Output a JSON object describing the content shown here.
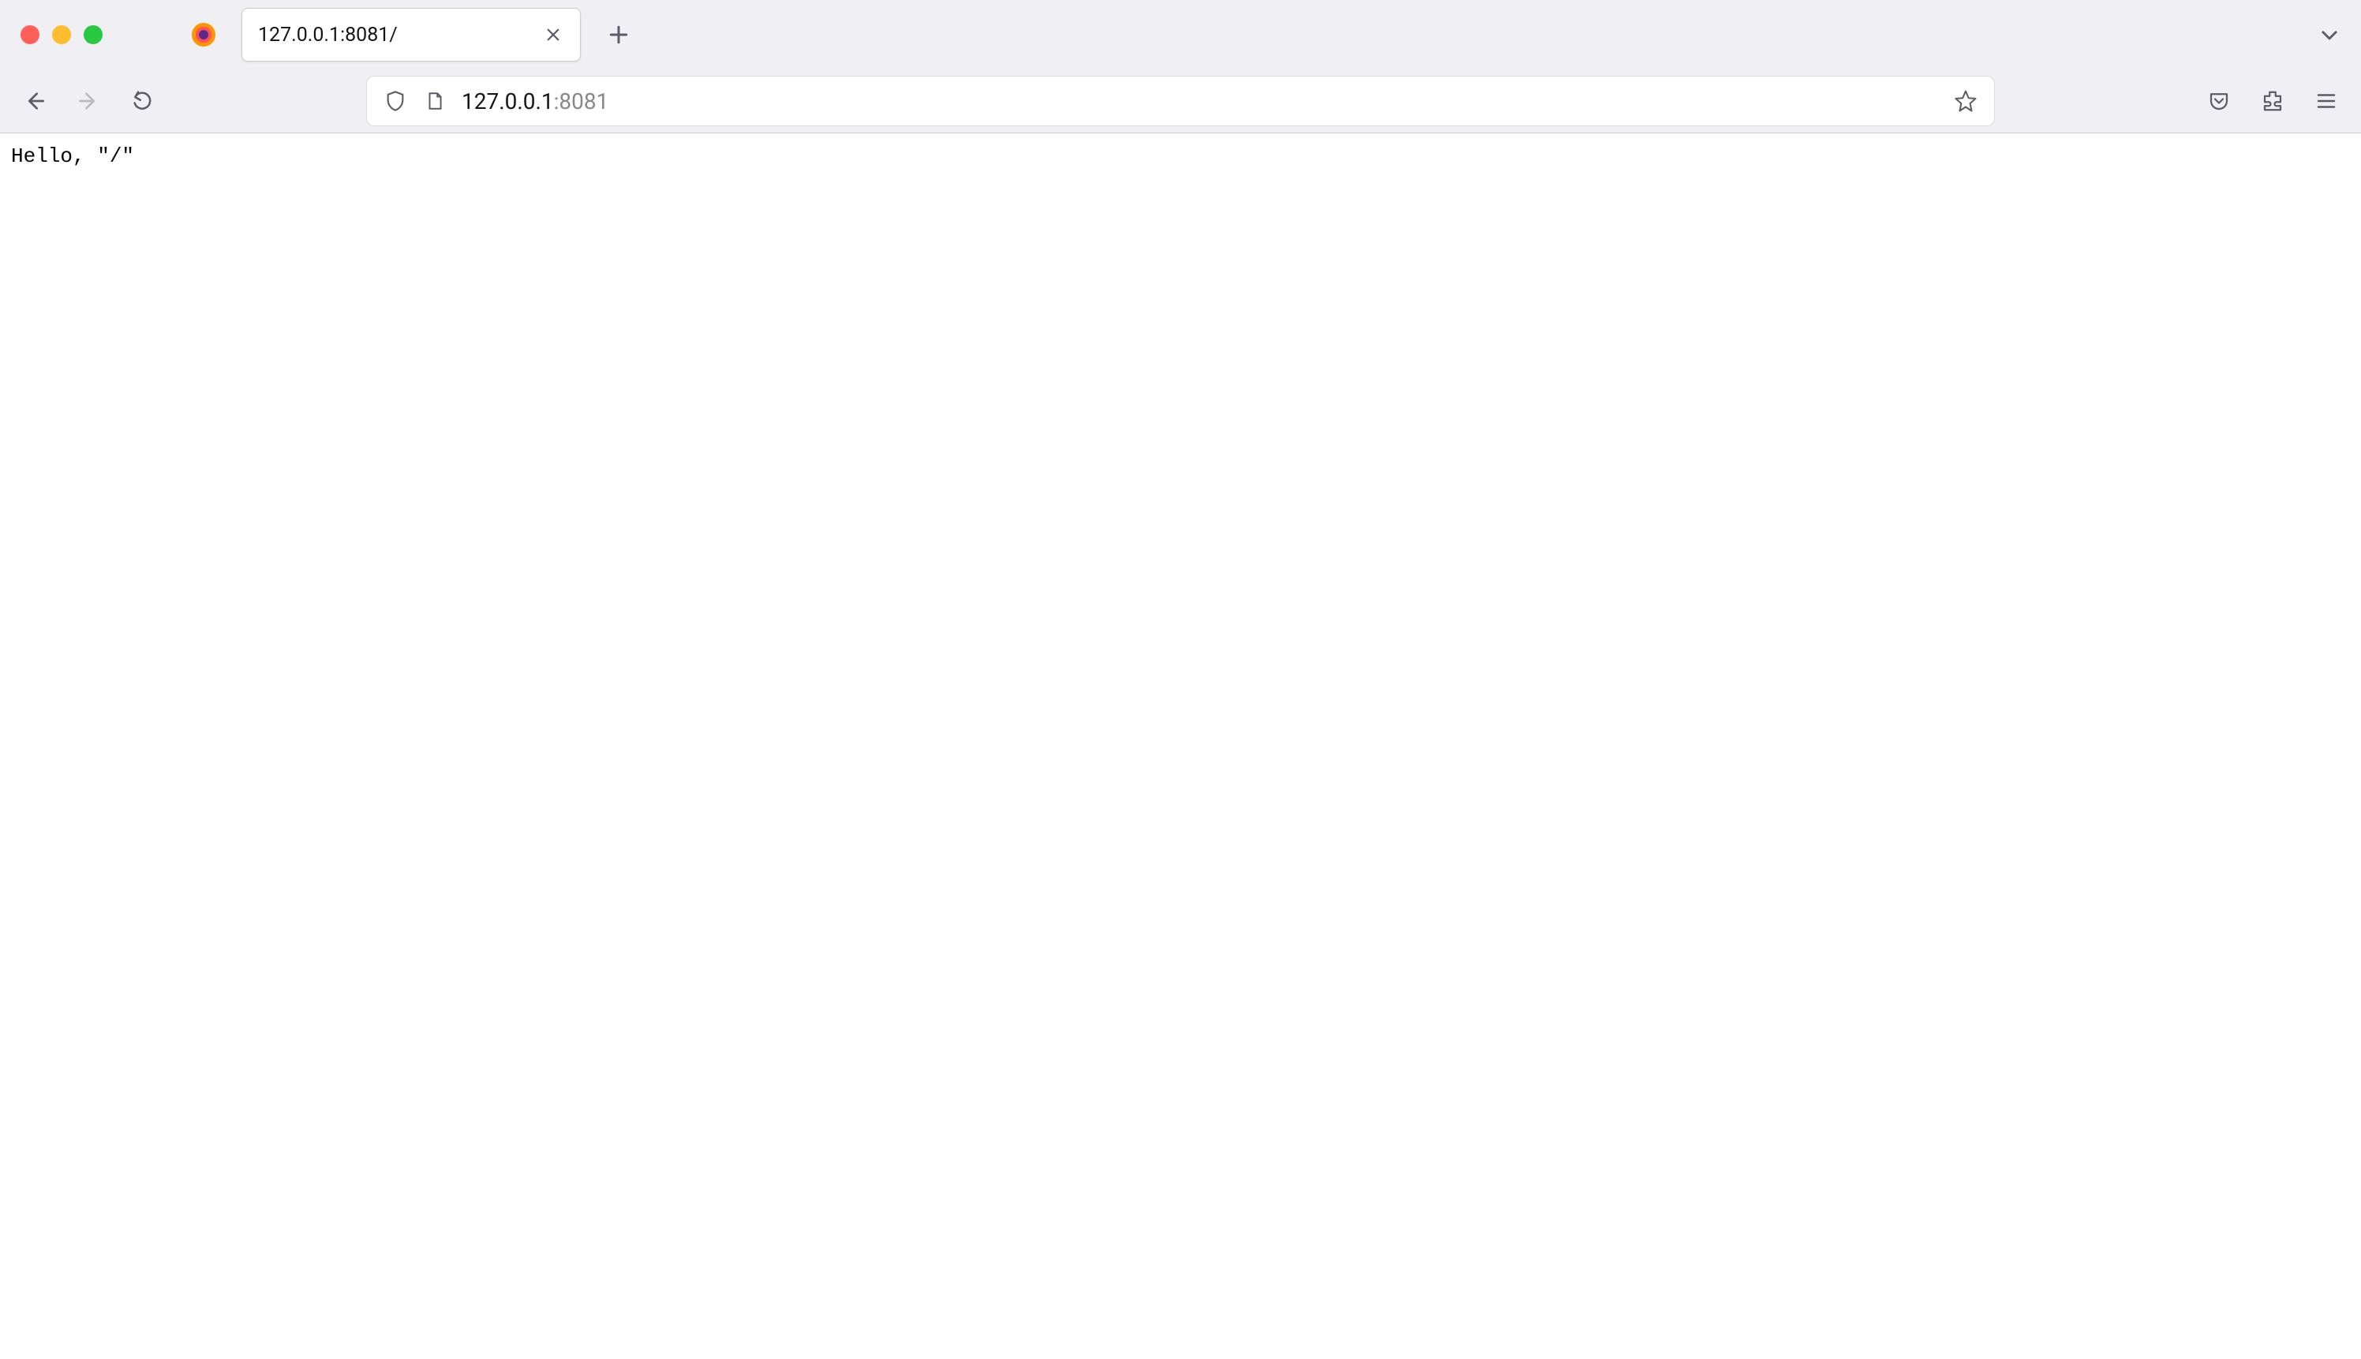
{
  "window": {
    "traffic_lights": {
      "close": "close",
      "minimize": "minimize",
      "maximize": "maximize"
    }
  },
  "tabs": {
    "active": {
      "title": "127.0.0.1:8081/"
    }
  },
  "urlbar": {
    "host": "127.0.0.1",
    "port": ":8081"
  },
  "page": {
    "body_text": "Hello, \"/\""
  }
}
